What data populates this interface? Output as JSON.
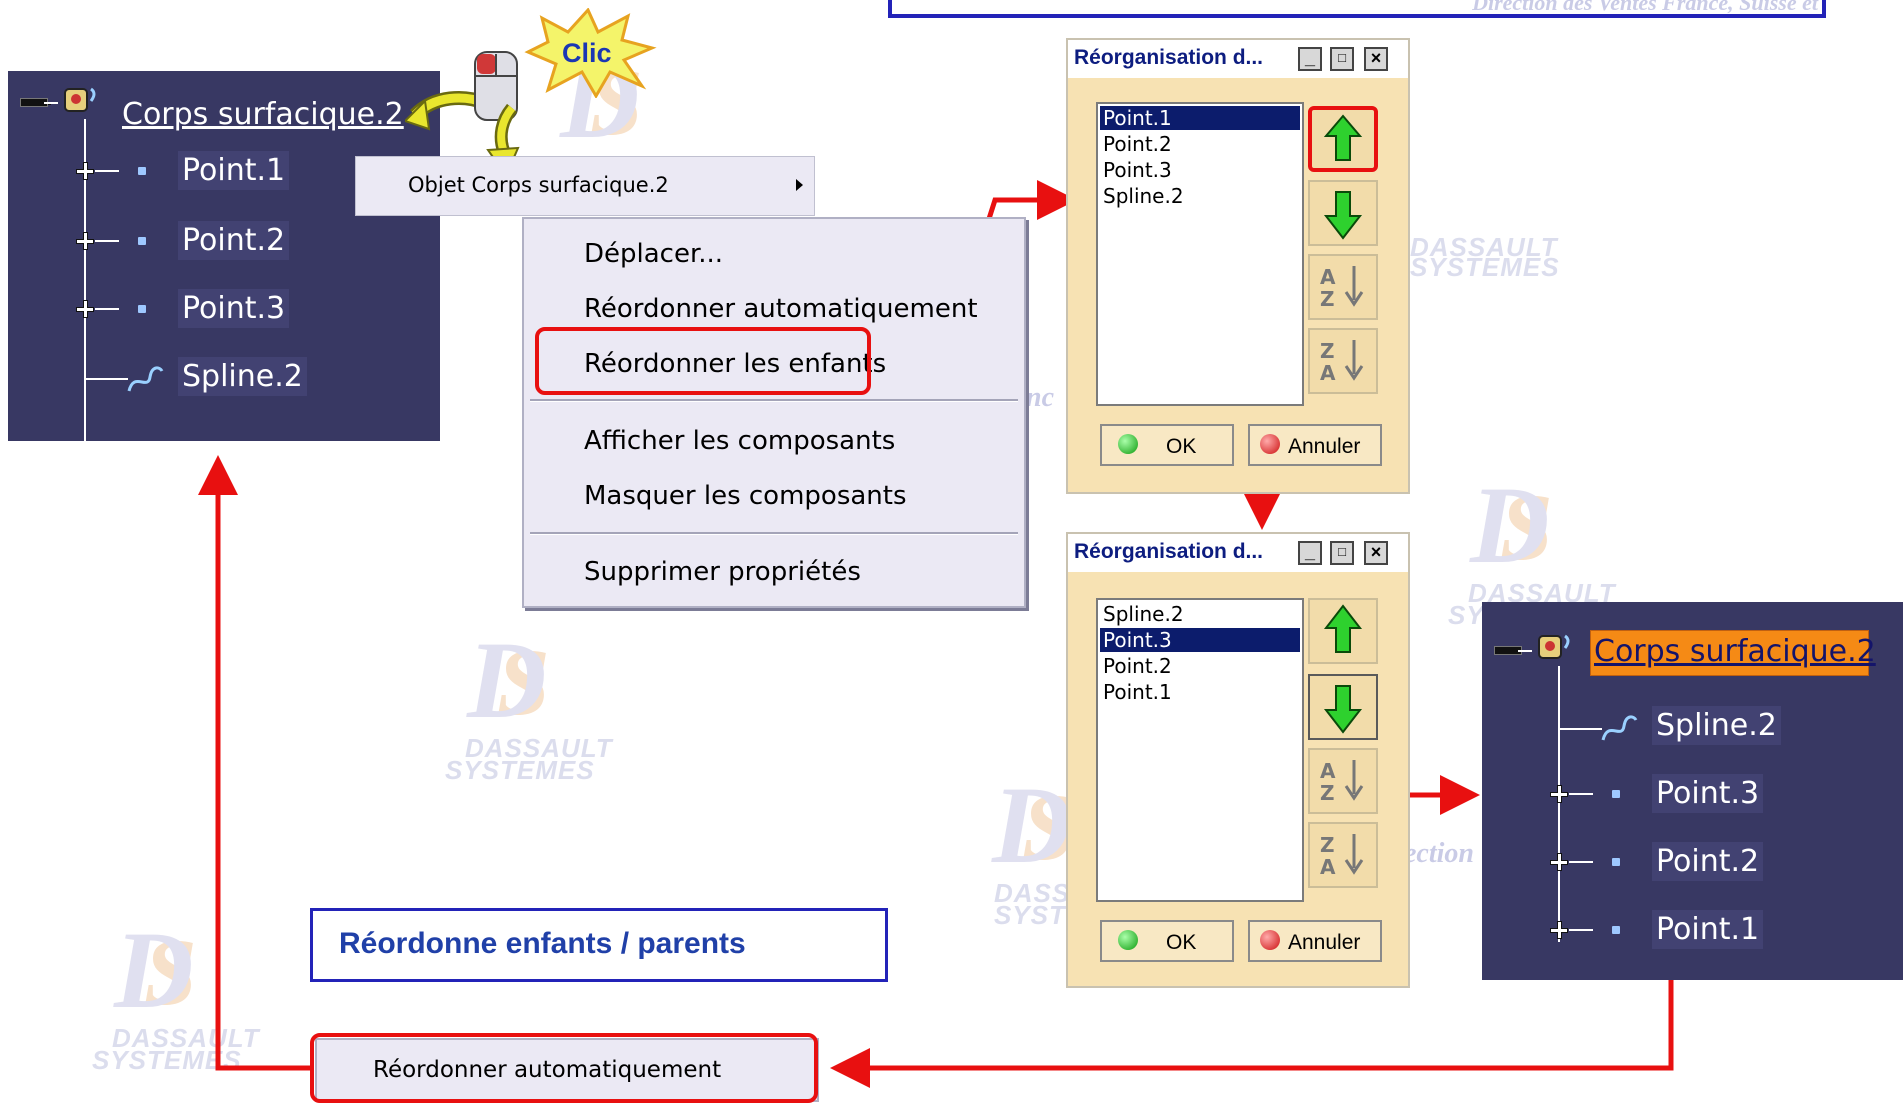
{
  "header": {
    "text": "Direction des Ventes France, Suisse et"
  },
  "watermark": {
    "line1": "DASSAULT",
    "line2": "SYSTEMES",
    "fragments": [
      "nc",
      "ection"
    ]
  },
  "clic_callout": {
    "label": "Clic"
  },
  "tree_before": {
    "root": "Corps surfacique.2",
    "children": [
      "Point.1",
      "Point.2",
      "Point.3",
      "Spline.2"
    ]
  },
  "context_menu": {
    "object_item": "Objet Corps surfacique.2",
    "items": [
      "Déplacer...",
      "Réordonner automatiquement",
      "Réordonner les enfants",
      "Afficher les composants",
      "Masquer les composants",
      "Supprimer propriétés"
    ]
  },
  "dialog_before": {
    "title": "Réorganisation d...",
    "items": [
      "Point.1",
      "Point.2",
      "Point.3",
      "Spline.2"
    ],
    "selected_index": 0,
    "ok_label": "OK",
    "cancel_label": "Annuler"
  },
  "dialog_after": {
    "title": "Réorganisation d...",
    "items": [
      "Spline.2",
      "Point.3",
      "Point.2",
      "Point.1"
    ],
    "selected_index": 1,
    "ok_label": "OK",
    "cancel_label": "Annuler"
  },
  "tree_after": {
    "root": "Corps surfacique.2",
    "children": [
      "Spline.2",
      "Point.3",
      "Point.2",
      "Point.1"
    ]
  },
  "caption": "Réordonne enfants / parents",
  "bottom_menu_item": "Réordonner automatiquement",
  "colors": {
    "accent_red": "#e81010",
    "tree_bg": "#383863",
    "dialog_bg": "#f7e2b3",
    "selection": "#0c1c6c",
    "caption_blue": "#2040a8"
  }
}
